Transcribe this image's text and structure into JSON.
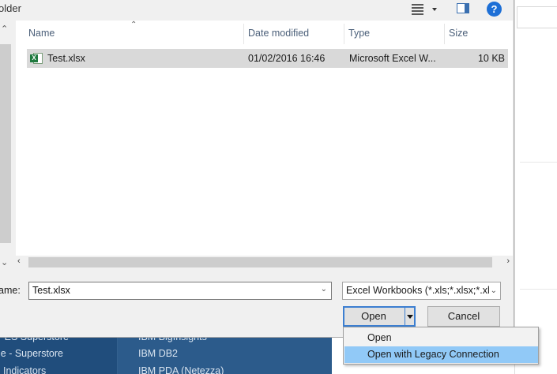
{
  "dialog": {
    "title_partial": "older",
    "help_label": "?"
  },
  "columns": [
    "Name",
    "Date modified",
    "Type",
    "Size"
  ],
  "files": [
    {
      "name": "Test.xlsx",
      "date": "01/02/2016 16:46",
      "type": "Microsoft Excel W...",
      "size": "10 KB",
      "icon": "excel-icon"
    }
  ],
  "filename": {
    "label": "ame:",
    "value": "Test.xlsx"
  },
  "filter": {
    "value": "Excel Workbooks (*.xls;*.xlsx;*.xl"
  },
  "buttons": {
    "open": "Open",
    "cancel": "Cancel"
  },
  "open_menu": {
    "items": [
      "Open",
      "Open with Legacy Connection"
    ],
    "highlighted_index": 1
  },
  "background": {
    "left_items": [
      "- ES Superstore",
      "le - Superstore",
      "Indicators"
    ],
    "right_items": [
      "IBM BigInsights",
      "IBM DB2",
      "IBM PDA (Netezza)"
    ]
  },
  "colors": {
    "accent": "#3c7fd1",
    "highlight": "#91c9f7",
    "background_panel": "#204d7c"
  }
}
